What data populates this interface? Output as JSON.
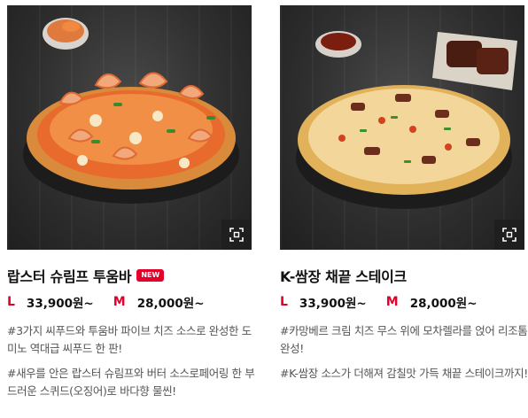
{
  "products": [
    {
      "name": "랍스터 슈림프 투움바",
      "badge": "NEW",
      "sizes": [
        {
          "size": "L",
          "price": "33,900원~"
        },
        {
          "size": "M",
          "price": "28,000원~"
        }
      ],
      "descriptions": [
        "#3가지 씨푸드와 투움바 파이브 치즈 소스로 완성한 도미노 역대급 씨푸드 한 판!",
        "#새우를 안은 랍스터 슈림프와 버터 소스로페어링 한 부드러운 스퀴드(오징어)로 바다향 물씬!"
      ],
      "zoom_icon": "zoom-expand-icon"
    },
    {
      "name": "K-쌈장 채끝 스테이크",
      "sizes": [
        {
          "size": "L",
          "price": "33,900원~"
        },
        {
          "size": "M",
          "price": "28,000원~"
        }
      ],
      "descriptions": [
        "#카망베르 크림 치즈 무스 위에 모차렐라를 얹어 리조톰 완성!",
        "#K-쌈장 소스가 더해져 감칠맛 가득 채끝 스테이크까지!"
      ],
      "zoom_icon": "zoom-expand-icon"
    }
  ],
  "colors": {
    "accent": "#e4002b",
    "background_dark": "#2f2f2f"
  }
}
